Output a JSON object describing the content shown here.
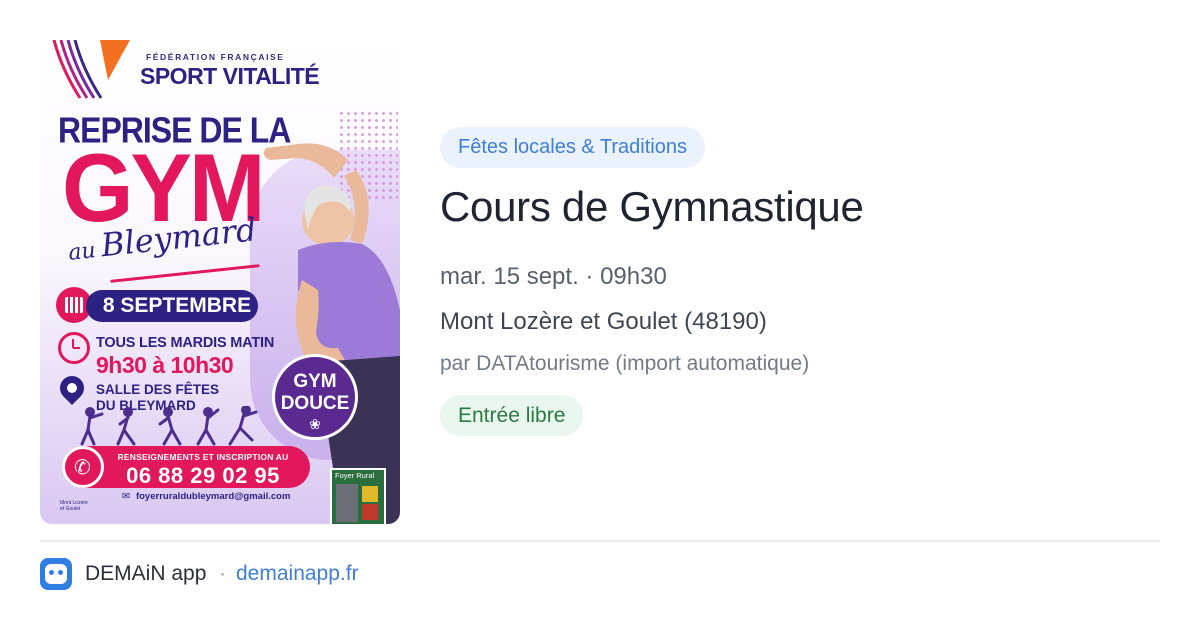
{
  "poster": {
    "federation": "FÉDÉRATION FRANÇAISE",
    "brand": "SPORT VITALITÉ",
    "headline_top": "REPRISE DE LA",
    "headline_main": "GYM",
    "place_au": "au",
    "place_name": "Bleymard",
    "date": "8 SEPTEMBRE",
    "schedule_line1": "TOUS LES MARDIS MATIN",
    "schedule_line2": "9h30 à 10h30",
    "venue_line1": "SALLE DES FÊTES",
    "venue_line2": "DU BLEYMARD",
    "badge_line1": "GYM",
    "badge_line2": "DOUCE",
    "contact_label": "RENSEIGNEMENTS ET INSCRIPTION AU",
    "phone": "06 88 29 02 95",
    "email": "foyerruraldubleymard@gmail.com",
    "partner_logo": "Foyer Rural",
    "mont_logo_line1": "Mont Lozère",
    "mont_logo_line2": "et Goulet",
    "colors": {
      "navy": "#2d2284",
      "pink": "#e3175c",
      "purple": "#5b2a91"
    }
  },
  "event": {
    "category": "Fêtes locales & Traditions",
    "title": "Cours de Gymnastique",
    "datetime": "mar. 15 sept. · 09h30",
    "location": "Mont Lozère et Goulet (48190)",
    "author": "par DATAtourisme (import automatique)",
    "price": "Entrée libre"
  },
  "footer": {
    "app_icon": "demain-app-icon",
    "app_name": "DEMAiN app",
    "separator": "·",
    "domain": "demainapp.fr"
  }
}
